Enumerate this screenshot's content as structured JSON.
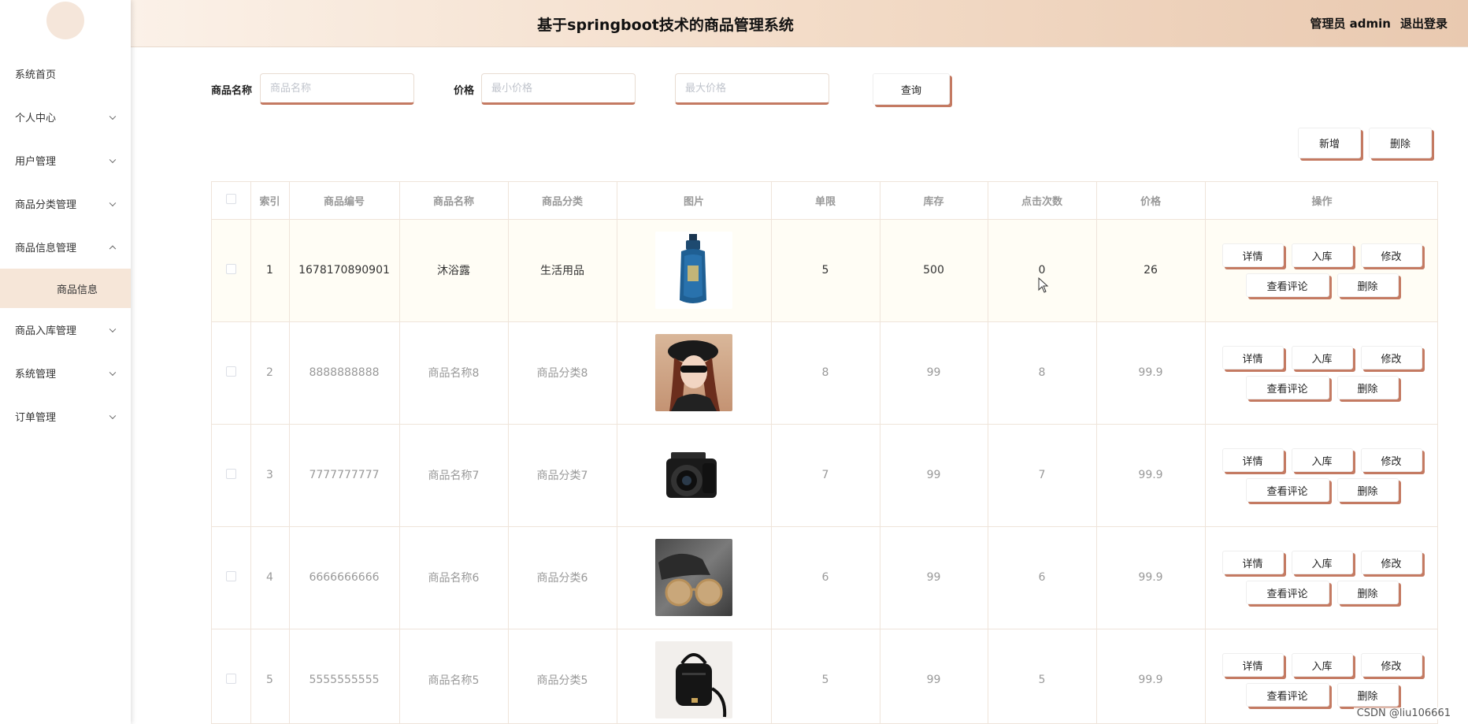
{
  "header": {
    "title": "基于springboot技术的商品管理系统",
    "user": "管理员 admin",
    "logout": "退出登录"
  },
  "sidebar": {
    "items": [
      {
        "label": "系统首页",
        "expandable": false
      },
      {
        "label": "个人中心",
        "expandable": true
      },
      {
        "label": "用户管理",
        "expandable": true
      },
      {
        "label": "商品分类管理",
        "expandable": true
      },
      {
        "label": "商品信息管理",
        "expandable": true,
        "expanded": true
      },
      {
        "label": "商品入库管理",
        "expandable": true
      },
      {
        "label": "系统管理",
        "expandable": true
      },
      {
        "label": "订单管理",
        "expandable": true
      }
    ],
    "sub_item": "商品信息"
  },
  "search": {
    "name_label": "商品名称",
    "name_placeholder": "商品名称",
    "price_label": "价格",
    "min_placeholder": "最小价格",
    "max_placeholder": "最大价格",
    "query_label": "查询"
  },
  "toolbar": {
    "add_label": "新增",
    "delete_label": "删除"
  },
  "table": {
    "columns": [
      "索引",
      "商品编号",
      "商品名称",
      "商品分类",
      "图片",
      "单限",
      "库存",
      "点击次数",
      "价格",
      "操作"
    ],
    "rows": [
      {
        "index": "1",
        "code": "1678170890901",
        "name": "沐浴露",
        "category": "生活用品",
        "image": "shampoo-bottle-image",
        "limit": "5",
        "stock": "500",
        "clicks": "0",
        "price": "26"
      },
      {
        "index": "2",
        "code": "8888888888",
        "name": "商品名称8",
        "category": "商品分类8",
        "image": "woman-hat-image",
        "limit": "8",
        "stock": "99",
        "clicks": "8",
        "price": "99.9"
      },
      {
        "index": "3",
        "code": "7777777777",
        "name": "商品名称7",
        "category": "商品分类7",
        "image": "camera-image",
        "limit": "7",
        "stock": "99",
        "clicks": "7",
        "price": "99.9"
      },
      {
        "index": "4",
        "code": "6666666666",
        "name": "商品名称6",
        "category": "商品分类6",
        "image": "sunglasses-image",
        "limit": "6",
        "stock": "99",
        "clicks": "6",
        "price": "99.9"
      },
      {
        "index": "5",
        "code": "5555555555",
        "name": "商品名称5",
        "category": "商品分类5",
        "image": "handbag-image",
        "limit": "5",
        "stock": "99",
        "clicks": "5",
        "price": "99.9"
      }
    ],
    "row_actions": {
      "detail": "详情",
      "stock_in": "入库",
      "edit": "修改",
      "comments": "查看评论",
      "delete": "删除"
    }
  },
  "watermark": "CSDN @liu106661",
  "colors": {
    "accent": "#c47a62",
    "header_start": "#fbf1e8",
    "header_end": "#e9c9b0",
    "active_menu": "#f6e6d8"
  }
}
